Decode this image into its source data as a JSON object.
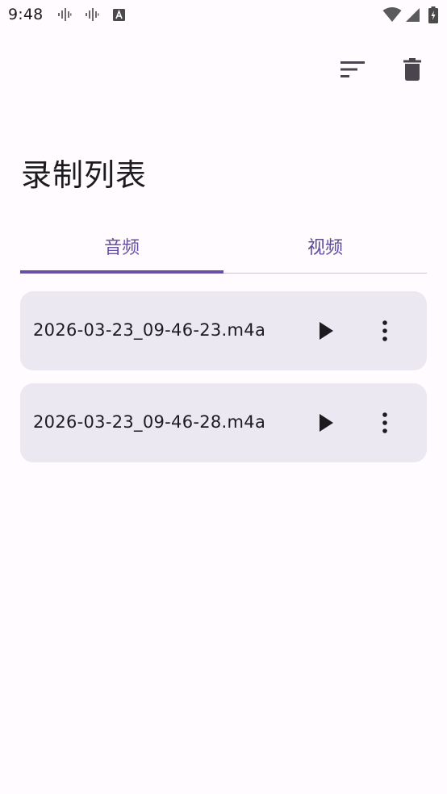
{
  "status_bar": {
    "time": "9:48",
    "icons": [
      "voice-activity-icon",
      "voice-activity-icon",
      "keyboard-a-icon",
      "wifi-icon",
      "signal-icon",
      "battery-charging-icon"
    ]
  },
  "toolbar": {
    "actions": [
      "sort-icon",
      "delete-icon"
    ]
  },
  "page": {
    "title": "录制列表"
  },
  "tabs": [
    {
      "label": "音频",
      "selected": true
    },
    {
      "label": "视频",
      "selected": false
    }
  ],
  "recordings": [
    {
      "name": "2026-03-23_09-46-23.m4a"
    },
    {
      "name": "2026-03-23_09-46-28.m4a"
    }
  ],
  "colors": {
    "accent": "#6750a4",
    "background": "#fffbfe",
    "card": "#ece8f2",
    "text": "#1c1b1f"
  }
}
